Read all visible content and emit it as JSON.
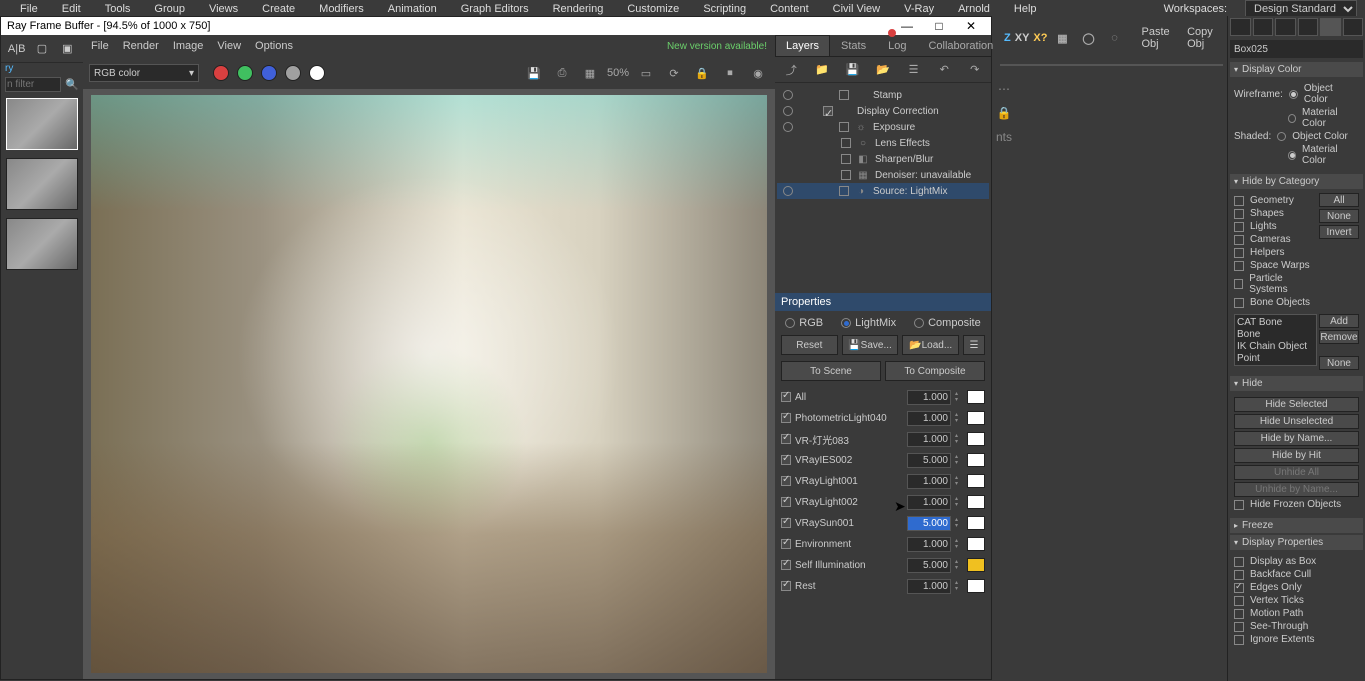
{
  "main_menu": [
    "File",
    "Edit",
    "Tools",
    "Group",
    "Views",
    "Create",
    "Modifiers",
    "Animation",
    "Graph Editors",
    "Rendering",
    "Customize",
    "Scripting",
    "Content",
    "Civil View",
    "V-Ray",
    "Arnold",
    "Help"
  ],
  "workspaces": {
    "label": "Workspaces:",
    "value": "Design Standard"
  },
  "vfb": {
    "title": "Ray Frame Buffer - [94.5% of 1000 x 750]",
    "menu": [
      "File",
      "Render",
      "Image",
      "View",
      "Options"
    ],
    "status": "New version available!",
    "color_mode": "RGB color",
    "swatches": [
      "#d94040",
      "#40c060",
      "#4060d9",
      "#a0a0a0",
      "#ffffff"
    ],
    "zoom": "50%",
    "tabs": [
      "Layers",
      "Stats",
      "Log",
      "Collaboration"
    ],
    "log_dot": "#d94040",
    "history_filter": "n filter",
    "tree": [
      {
        "eye": true,
        "indent": 1,
        "check": false,
        "icon": "",
        "label": "Stamp"
      },
      {
        "eye": true,
        "indent": 0,
        "check": true,
        "icon": "",
        "label": "Display Correction"
      },
      {
        "eye": true,
        "indent": 1,
        "check": false,
        "icon": "☼",
        "label": "Exposure"
      },
      {
        "eye": false,
        "indent": 1,
        "check": false,
        "icon": "○",
        "label": "Lens Effects"
      },
      {
        "eye": false,
        "indent": 1,
        "check": false,
        "icon": "◧",
        "label": "Sharpen/Blur"
      },
      {
        "eye": false,
        "indent": 1,
        "check": false,
        "icon": "▦",
        "label": "Denoiser: unavailable"
      },
      {
        "eye": true,
        "indent": 1,
        "check": false,
        "icon": "◑",
        "label": "Source: LightMix",
        "sel": true
      }
    ],
    "props": "Properties",
    "modeA": "RGB",
    "modeB": "LightMix",
    "modeC": "Composite",
    "reset": "Reset",
    "save": "Save...",
    "load": "Load...",
    "toScene": "To Scene",
    "toComposite": "To Composite",
    "lights": [
      {
        "on": true,
        "name": "All",
        "val": "1.000",
        "sw": "#ffffff"
      },
      {
        "on": true,
        "name": "PhotometricLight040",
        "val": "1.000",
        "sw": "#ffffff"
      },
      {
        "on": true,
        "name": "VR-灯光083",
        "val": "1.000",
        "sw": "#ffffff"
      },
      {
        "on": true,
        "name": "VRayIES002",
        "val": "5.000",
        "sw": "#ffffff"
      },
      {
        "on": true,
        "name": "VRayLight001",
        "val": "1.000",
        "sw": "#ffffff"
      },
      {
        "on": true,
        "name": "VRayLight002",
        "val": "1.000",
        "sw": "#ffffff"
      },
      {
        "on": true,
        "name": "VRaySun001",
        "val": "5.000",
        "sw": "#ffffff",
        "selVal": true
      },
      {
        "on": true,
        "name": "Environment",
        "val": "1.000",
        "sw": "#ffffff"
      },
      {
        "on": true,
        "name": "Self Illumination",
        "val": "5.000",
        "sw": "#f0c020"
      },
      {
        "on": true,
        "name": "Rest",
        "val": "1.000",
        "sw": "#ffffff"
      }
    ]
  },
  "max": {
    "axis": [
      "Z",
      "XY",
      "X?"
    ],
    "paste": "Paste Obj",
    "copy": "Copy Obj",
    "obj": "Box025",
    "rollouts": {
      "displayColor": {
        "title": "Display Color",
        "wireframe": "Wireframe:",
        "objColor": "Object Color",
        "matColor": "Material Color",
        "shaded": "Shaded:"
      },
      "hideCategory": {
        "title": "Hide by Category",
        "items": [
          "Geometry",
          "Shapes",
          "Lights",
          "Cameras",
          "Helpers",
          "Space Warps",
          "Particle Systems",
          "Bone Objects"
        ],
        "btns": [
          "All",
          "None",
          "Invert"
        ],
        "list": [
          "CAT Bone",
          "Bone",
          "IK Chain Object",
          "Point"
        ],
        "add": "Add",
        "remove": "Remove",
        "none": "None"
      },
      "hide": {
        "title": "Hide",
        "btns": [
          "Hide Selected",
          "Hide Unselected",
          "Hide by Name...",
          "Hide by Hit",
          "Unhide All",
          "Unhide by Name..."
        ],
        "frozen": "Hide Frozen Objects"
      },
      "freeze": {
        "title": "Freeze"
      },
      "displayProps": {
        "title": "Display Properties",
        "items": [
          "Display as Box",
          "Backface Cull",
          "Edges Only",
          "Vertex Ticks",
          "Motion Path",
          "See-Through",
          "Ignore Extents"
        ],
        "checked": [
          false,
          false,
          true,
          false,
          false,
          false,
          false
        ]
      }
    }
  }
}
